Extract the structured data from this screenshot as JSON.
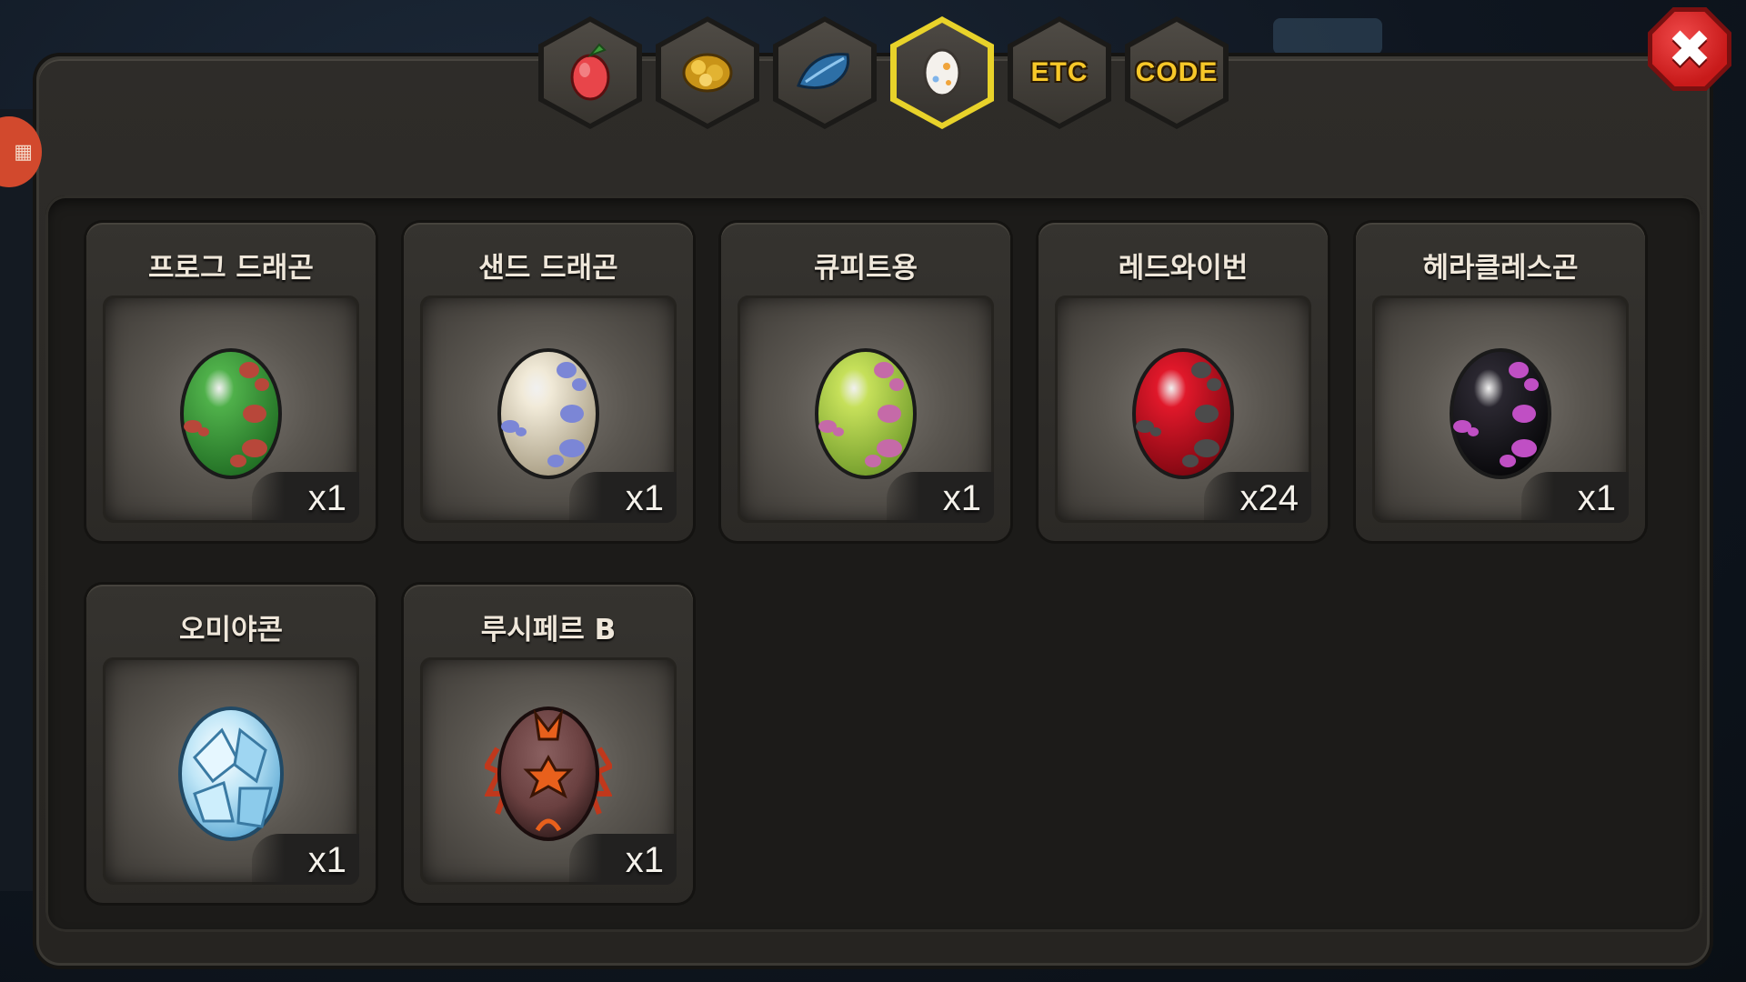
{
  "tabs": [
    {
      "id": "fruit",
      "icon": "fruit-icon",
      "text": ""
    },
    {
      "id": "gold",
      "icon": "gold-nugget-icon",
      "text": ""
    },
    {
      "id": "feather",
      "icon": "feather-icon",
      "text": ""
    },
    {
      "id": "egg",
      "icon": "egg-icon",
      "text": "",
      "active": true
    },
    {
      "id": "etc",
      "icon": "",
      "text": "ETC"
    },
    {
      "id": "code",
      "icon": "",
      "text": "CODE"
    }
  ],
  "close_icon": "close-icon",
  "items": [
    {
      "name": "프로그 드래곤",
      "qty": "x1",
      "egg": {
        "base": "#4fb04a",
        "shade": "#1f6b22",
        "spot": "#b8473a"
      }
    },
    {
      "name": "샌드 드래곤",
      "qty": "x1",
      "egg": {
        "base": "#f1ead8",
        "shade": "#a59a80",
        "spot": "#7b86d6"
      }
    },
    {
      "name": "큐피트용",
      "qty": "x1",
      "egg": {
        "base": "#c6e05a",
        "shade": "#6f9a2a",
        "spot": "#c56aa8"
      }
    },
    {
      "name": "레드와이번",
      "qty": "x24",
      "egg": {
        "base": "#e0182a",
        "shade": "#7a0610",
        "spot": "#4b4b4b"
      }
    },
    {
      "name": "헤라클레스곤",
      "qty": "x1",
      "egg": {
        "base": "#2a2730",
        "shade": "#060608",
        "spot": "#c04fc4"
      }
    },
    {
      "name": "오미야콘",
      "qty": "x1",
      "egg": {
        "type": "ice",
        "base": "#bfe6f7",
        "shade": "#5ca9d4",
        "spot": "#ffffff"
      }
    },
    {
      "name": "루시페르 B",
      "qty": "x1",
      "egg": {
        "type": "lucifer",
        "base": "#6a4040",
        "shade": "#2e1a1a",
        "spot": "#e8601c"
      }
    }
  ]
}
